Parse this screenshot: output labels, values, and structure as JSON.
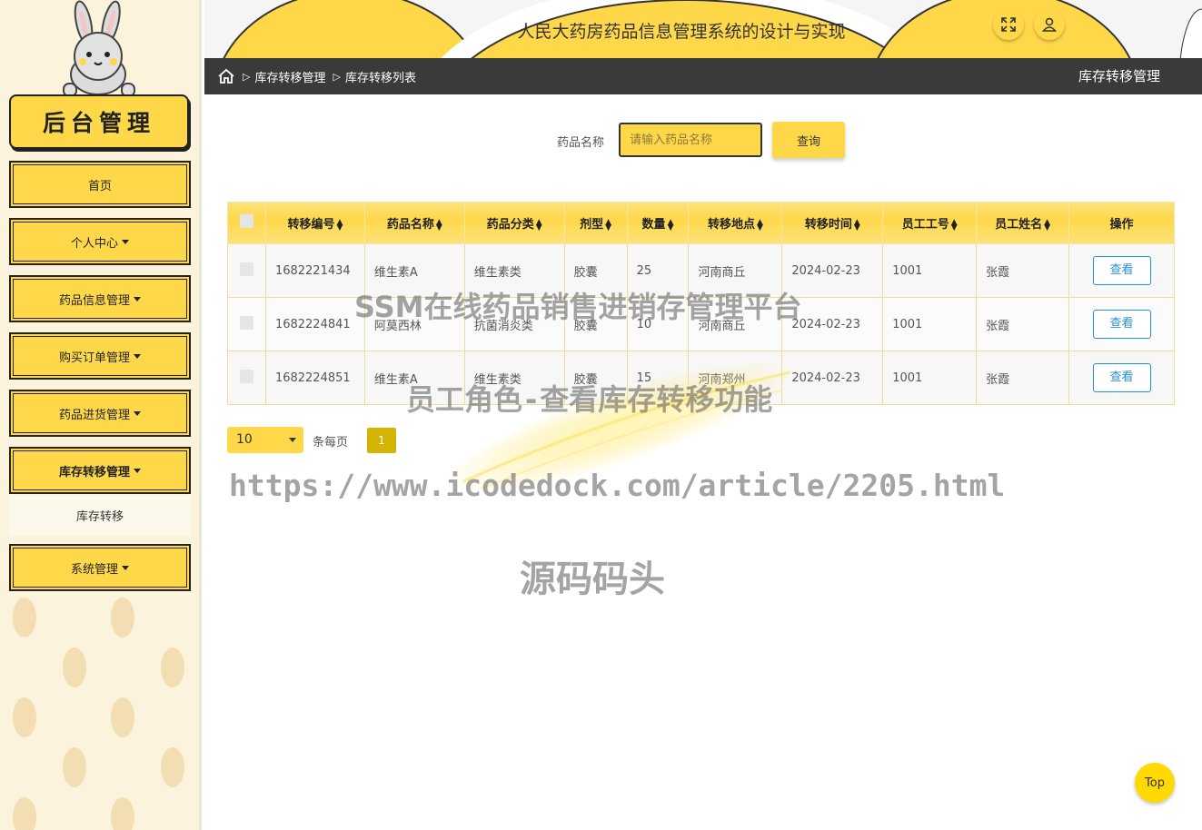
{
  "sidebar": {
    "brand": "后台管理",
    "menu": [
      {
        "label": "首页",
        "has_caret": false
      },
      {
        "label": "个人中心",
        "has_caret": true
      },
      {
        "label": "药品信息管理",
        "has_caret": true
      },
      {
        "label": "购买订单管理",
        "has_caret": true
      },
      {
        "label": "药品进货管理",
        "has_caret": true
      },
      {
        "label": "库存转移管理",
        "has_caret": true,
        "active": true
      },
      {
        "label": "系统管理",
        "has_caret": true
      }
    ],
    "submenu_item": "库存转移"
  },
  "header": {
    "title": "人民大药房药品信息管理系统的设计与实现",
    "icons": [
      "fullscreen-icon",
      "user-icon"
    ]
  },
  "breadcrumb": {
    "items": [
      "库存转移管理",
      "库存转移列表"
    ],
    "right_title": "库存转移管理"
  },
  "search": {
    "label": "药品名称",
    "placeholder": "请输入药品名称",
    "button": "查询"
  },
  "table": {
    "columns": [
      "转移编号",
      "药品名称",
      "药品分类",
      "剂型",
      "数量",
      "转移地点",
      "转移时间",
      "员工工号",
      "员工姓名",
      "操作"
    ],
    "rows": [
      [
        "1682221434",
        "维生素A",
        "维生素类",
        "胶囊",
        "25",
        "河南商丘",
        "2024-02-23",
        "1001",
        "张霞"
      ],
      [
        "1682224841",
        "阿莫西林",
        "抗菌消炎类",
        "胶囊",
        "10",
        "河南商丘",
        "2024-02-23",
        "1001",
        "张霞"
      ],
      [
        "1682224851",
        "维生素A",
        "维生素类",
        "胶囊",
        "15",
        "河南郑州",
        "2024-02-23",
        "1001",
        "张霞"
      ]
    ],
    "view_label": "查看"
  },
  "pagination": {
    "page_size": "10",
    "per_page_label": "条每页",
    "current_page": "1"
  },
  "watermark": {
    "line1": "SSM在线药品销售进销存管理平台",
    "line2": "员工角色-查看库存转移功能",
    "url": "https://www.icodedock.com/article/2205.html",
    "site": "源码码头"
  },
  "top_button": "Top",
  "colors": {
    "accent": "#ffd84a",
    "dark_bar": "#3a3a3a",
    "link_blue": "#2a8fd0",
    "page_active": "#d4b400"
  }
}
